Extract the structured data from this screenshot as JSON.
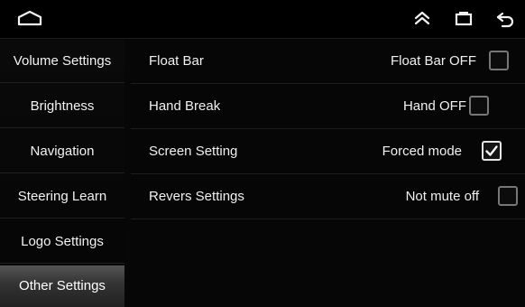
{
  "topbar": {
    "icons": [
      "home-icon",
      "collapse-icon",
      "recent-apps-icon",
      "back-icon"
    ]
  },
  "sidebar": {
    "items": [
      {
        "label": "Volume Settings"
      },
      {
        "label": "Brightness"
      },
      {
        "label": "Navigation"
      },
      {
        "label": "Steering Learn"
      },
      {
        "label": "Logo Settings"
      },
      {
        "label": "Other Settings",
        "active": true
      }
    ]
  },
  "settings": {
    "rows": [
      {
        "label": "Float Bar",
        "value": "Float Bar OFF",
        "checked": false
      },
      {
        "label": "Hand Break",
        "value": "Hand OFF",
        "checked": false
      },
      {
        "label": "Screen Setting",
        "value": "Forced mode",
        "checked": true
      },
      {
        "label": "Revers Settings",
        "value": "Not mute off",
        "checked": false
      }
    ]
  },
  "colors": {
    "background": "#070707",
    "active_item": "#444444",
    "text": "#f0f0f0"
  }
}
